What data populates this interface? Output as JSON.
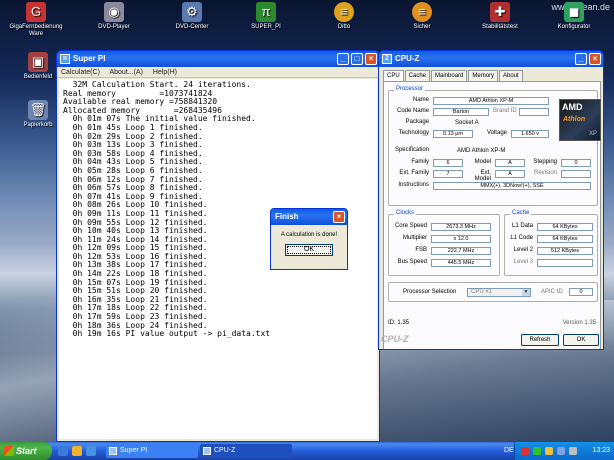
{
  "desktop": {
    "watermark": "www.ocean.de",
    "icons": [
      {
        "label": "GigaFernbedienung Ware",
        "glyph": "G",
        "color": "#c83232"
      },
      {
        "label": "DVD-Player",
        "glyph": "◉",
        "color": "#8a8a9a"
      },
      {
        "label": "DVD-Center",
        "glyph": "⚙",
        "color": "#5a7ab0"
      },
      {
        "label": "SUPER_PI",
        "glyph": "π",
        "color": "#2e8a2e"
      },
      {
        "label": "Ditto",
        "glyph": "≡",
        "color": "#e0a020"
      },
      {
        "label": "Sicher",
        "glyph": "≡",
        "color": "#e09020"
      },
      {
        "label": "Stabilitätstest",
        "glyph": "✚",
        "color": "#b03030"
      },
      {
        "label": "Konfigurator",
        "glyph": "◼",
        "color": "#30a060"
      },
      {
        "label": "Bedienfeld",
        "glyph": "▣",
        "color": "#a04040"
      },
      {
        "label": "Papierkorb",
        "glyph": "🗑",
        "color": "#6b85b0"
      }
    ]
  },
  "superpi": {
    "title": "Super PI",
    "menu": [
      "Calculate(C)",
      "About...(A)",
      "Help(H)"
    ],
    "lines": [
      "  32M Calculation Start. 24 iterations.",
      "Real memory         =1073741824",
      "Available real memory =758841320",
      "Allocated memory       =268435496",
      "  0h 01m 07s The initial value finished.",
      "  0h 01m 45s Loop 1 finished.",
      "  0h 02m 29s Loop 2 finished.",
      "  0h 03m 13s Loop 3 finished.",
      "  0h 03m 58s Loop 4 finished.",
      "  0h 04m 43s Loop 5 finished.",
      "  0h 05m 28s Loop 6 finished.",
      "  0h 06m 12s Loop 7 finished.",
      "  0h 06m 57s Loop 8 finished.",
      "  0h 07m 41s Loop 9 finished.",
      "  0h 08m 26s Loop 10 finished.",
      "  0h 09m 11s Loop 11 finished.",
      "  0h 09m 55s Loop 12 finished.",
      "  0h 10m 40s Loop 13 finished.",
      "  0h 11m 24s Loop 14 finished.",
      "  0h 12m 09s Loop 15 finished.",
      "  0h 12m 53s Loop 16 finished.",
      "  0h 13m 38s Loop 17 finished.",
      "  0h 14m 22s Loop 18 finished.",
      "  0h 15m 07s Loop 19 finished.",
      "  0h 15m 51s Loop 20 finished.",
      "  0h 16m 35s Loop 21 finished.",
      "  0h 17m 18s Loop 22 finished.",
      "  0h 17m 59s Loop 23 finished.",
      "  0h 18m 36s Loop 24 finished.",
      "  0h 19m 16s PI value output -> pi_data.txt"
    ]
  },
  "finish_dialog": {
    "title": "Finish",
    "message": "A calculation is done!",
    "ok_label": "OK"
  },
  "cpuz": {
    "title": "CPU-Z",
    "tabs": [
      "CPU",
      "Cache",
      "Mainboard",
      "Memory",
      "About"
    ],
    "active_tab": "CPU",
    "processor": {
      "group_title": "Processor",
      "name_label": "Name",
      "name": "AMD Athlon XP-M",
      "codename_label": "Code Name",
      "codename": "Barton",
      "brand_label": "Brand ID",
      "brand": "",
      "package_label": "Package",
      "package": "Socket A",
      "technology_label": "Technology",
      "technology": "0.13 µm",
      "voltage_label": "Voltage",
      "voltage": "1.650 v"
    },
    "spec": {
      "spec_label": "Specification",
      "spec": "AMD Athlon XP-M",
      "family_label": "Family",
      "family": "6",
      "model_label": "Model",
      "model": "A",
      "stepping_label": "Stepping",
      "stepping": "0",
      "extfamily_label": "Ext. Family",
      "extfamily": "7",
      "extmodel_label": "Ext. Model",
      "extmodel": "A",
      "revision_label": "Revision",
      "revision": "",
      "instr_label": "Instructions",
      "instr": "MMX(+), 3DNow!(+), SSE"
    },
    "clocks": {
      "group_title": "Clocks",
      "core_label": "Core Speed",
      "core": "2673.3 MHz",
      "mult_label": "Multiplier",
      "mult": "x 12.0",
      "fsb_label": "FSB",
      "fsb": "222.7 MHz",
      "bus_label": "Bus Speed",
      "bus": "445.5 MHz"
    },
    "cache": {
      "group_title": "Cache",
      "l1d_label": "L1 Data",
      "l1d": "64 KBytes",
      "l1c_label": "L1 Code",
      "l1c": "64 KBytes",
      "l2_label": "Level 2",
      "l2": "512 KBytes",
      "l3_label": "Level 3",
      "l3": ""
    },
    "selection_label": "Processor Selection",
    "selection": "CPU #1",
    "apic_label": "APIC ID",
    "apic": "0",
    "version_id": "ID: 1.35",
    "version": "Version 1.35",
    "brand": "CPU-Z",
    "refresh_label": "Refresh",
    "ok_label": "OK"
  },
  "taskbar": {
    "start_label": "Start",
    "tasks": [
      "Super PI",
      "CPU-Z"
    ],
    "lang": "DE",
    "clock": "13:23"
  }
}
